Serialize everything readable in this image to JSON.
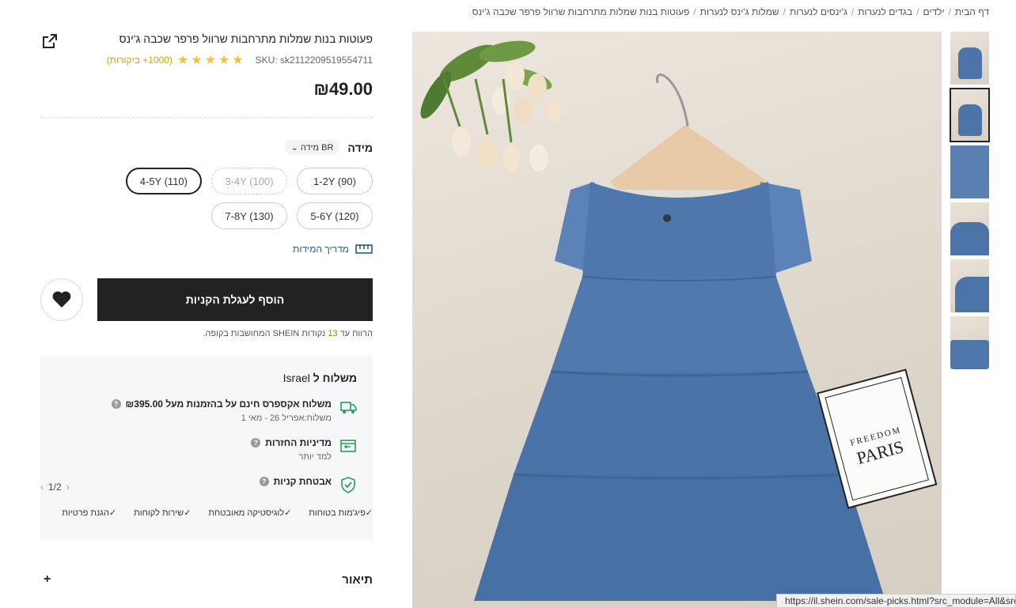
{
  "breadcrumb": [
    "דף הבית",
    "ילדים",
    "בגדים לנערות",
    "ג'ינסים לנערות",
    "שמלות ג'ינס לנערות",
    "פעוטות בנות שמלות מתרחבות שרוול פרפר שכבה ג'ינס"
  ],
  "product": {
    "title": "פעוטות בנות שמלות מתרחבות שרוול פרפר שכבה ג'ינס",
    "sku": "SKU: sk2112209519554711",
    "rating": 5,
    "reviews": "(1000+ ביקורות)",
    "price": "₪49.00"
  },
  "size": {
    "label": "מידה",
    "selector": "BR מידה",
    "options": [
      {
        "label": "1-2Y (90)",
        "state": "normal"
      },
      {
        "label": "3-4Y (100)",
        "state": "disabled"
      },
      {
        "label": "4-5Y (110)",
        "state": "selected"
      },
      {
        "label": "5-6Y (120)",
        "state": "normal"
      },
      {
        "label": "7-8Y (130)",
        "state": "normal"
      }
    ],
    "guide": "מדריך המידות"
  },
  "cart": {
    "add_label": "הוסף לעגלת הקניות",
    "points_pre": "הרווח עד",
    "points_num": "13",
    "points_post": "נקודות SHEIN המחושבות בקופה."
  },
  "shipping": {
    "title": "משלוח ל",
    "country": "Israel",
    "items": [
      {
        "head": "משלוח אקספרס חינם על בהזמנות מעל ₪395.00",
        "sub": "משלוח:אפריל 26 - מאי 1",
        "icon": "truck-icon"
      },
      {
        "head": "מדיניות החזרות",
        "sub": "למד יותר",
        "icon": "return-icon"
      },
      {
        "head": "אבטחת קניות",
        "sub": "",
        "icon": "shield-check-icon"
      }
    ],
    "pager": "1/2",
    "guarantees": [
      "פיג'מות בטוחות",
      "לוגיסטיקה מאובטחת",
      "שירות לקוחות",
      "הגנת פרטיות"
    ]
  },
  "description": {
    "label": "תיאור",
    "toggle": "+"
  },
  "image": {
    "tag_line1": "FREEDOM",
    "tag_line2": "PARIS"
  },
  "status_url": "https://il.shein.com/sale-picks.html?src_module=All&src",
  "colors": {
    "accent": "#222222",
    "star": "#f6c23e",
    "reviews": "#d4a300",
    "denim": "#4d74a8",
    "green": "#2a9d5c"
  }
}
